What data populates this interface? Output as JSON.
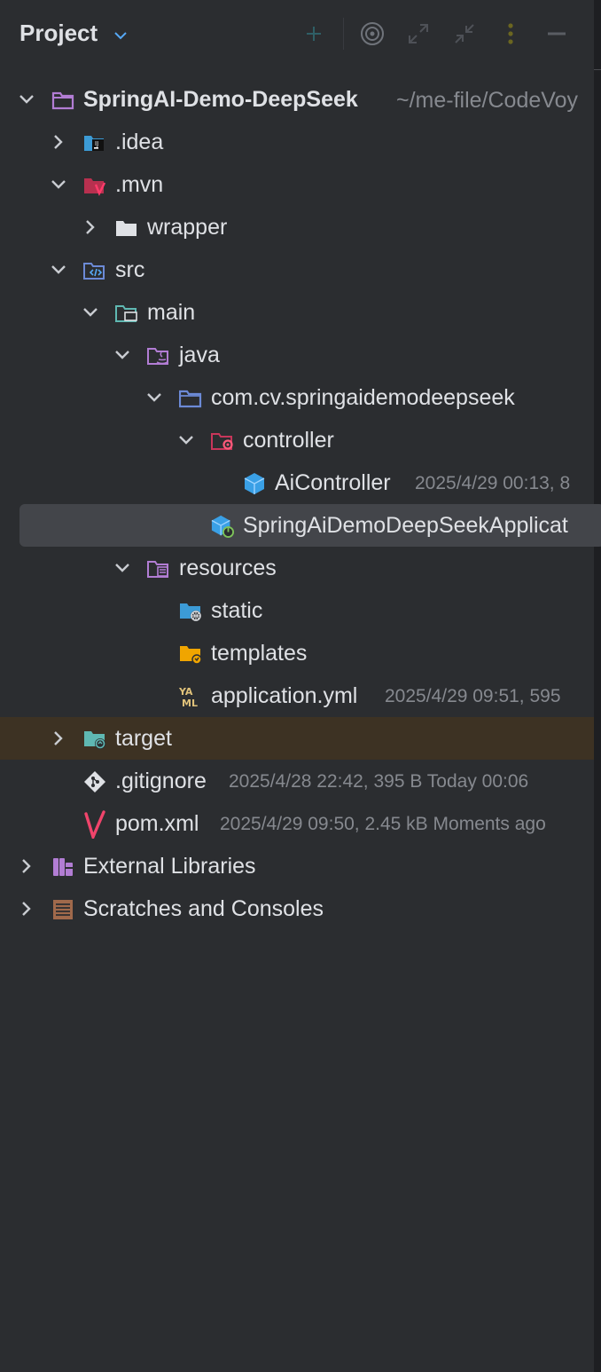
{
  "panel": {
    "title": "Project",
    "toolbar": [
      "add-icon",
      "locate-icon",
      "expand-all-icon",
      "collapse-all-icon",
      "options-icon",
      "hide-icon"
    ]
  },
  "tree": {
    "root": {
      "name": "SpringAI-Demo-DeepSeek",
      "path": "~/me-file/CodeVoy"
    },
    "idea": "idea",
    "mvn": "mvn",
    "wrapper": "wrapper",
    "src": "src",
    "main": "main",
    "java": "java",
    "package": "com.cv.springaidemodeepseek",
    "controller": "controller",
    "ai_controller": {
      "name": "AiController",
      "meta": "2025/4/29 00:13, 8"
    },
    "application_class": "SpringAiDemoDeepSeekApplicat",
    "resources": "resources",
    "static": "static",
    "templates": "templates",
    "application_yml": {
      "name": "application.yml",
      "meta": "2025/4/29 09:51, 595"
    },
    "target": "target",
    "gitignore": {
      "name": ".gitignore",
      "meta": "2025/4/28 22:42, 395 B Today 00:06"
    },
    "pom": {
      "name": "pom.xml",
      "meta": "2025/4/29 09:50, 2.45 kB Moments ago"
    },
    "external_libraries": "External Libraries",
    "scratches": "Scratches and Consoles"
  },
  "colors": {
    "background": "#2b2d30",
    "selection": "#43454a",
    "excluded_row": "#3d3223",
    "text": "#dfe1e5",
    "meta_text": "#86898f",
    "accent_blue": "#56a8f5"
  }
}
